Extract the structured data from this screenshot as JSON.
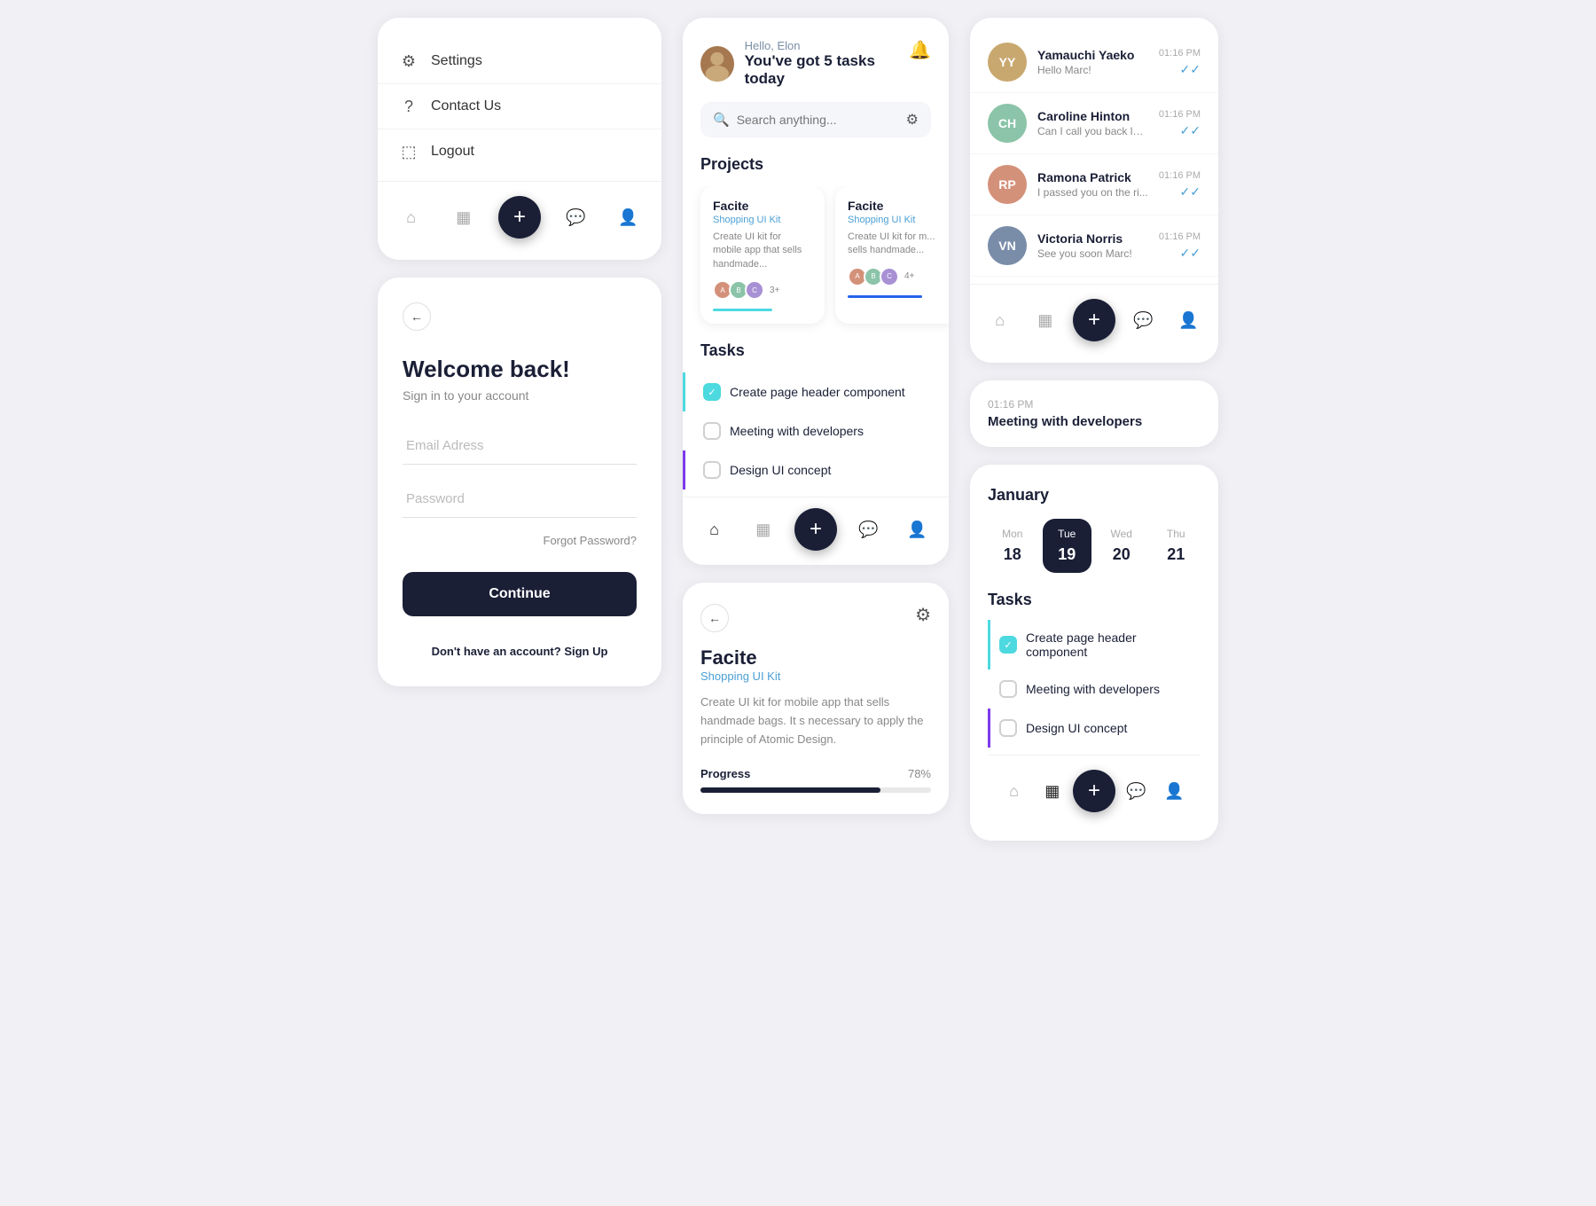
{
  "leftCol": {
    "menu": {
      "items": [
        {
          "icon": "⚙️",
          "label": "Settings"
        },
        {
          "icon": "?",
          "label": "Contact Us"
        },
        {
          "icon": "⬛",
          "label": "Logout"
        }
      ]
    },
    "login": {
      "backLabel": "←",
      "title": "Welcome back!",
      "subtitle": "Sign in to your account",
      "emailPlaceholder": "Email Adress",
      "passwordPlaceholder": "Password",
      "forgotLabel": "Forgot Password?",
      "continueLabel": "Continue",
      "noAccountText": "Don't have an account?",
      "signUpLabel": "Sign Up"
    }
  },
  "midCol": {
    "home": {
      "greeting": "Hello, Elon",
      "taskSummary": "You've got 5 tasks today",
      "searchPlaceholder": "Search anything...",
      "projectsTitle": "Projects",
      "projects": [
        {
          "name": "Facite",
          "sub": "Shopping UI Kit",
          "desc": "Create UI kit for mobile app that sells handmade...",
          "avatars": [
            "A",
            "B",
            "C"
          ],
          "count": "3+",
          "progClass": "prog-cyan"
        },
        {
          "name": "Facite",
          "sub": "Shopping UI Kit",
          "desc": "Create UI kit for m... sells handmade...",
          "avatars": [
            "A",
            "B",
            "C"
          ],
          "count": "4+",
          "progClass": "prog-blue"
        }
      ],
      "tasksTitle": "Tasks",
      "tasks": [
        {
          "label": "Create page header component",
          "checked": true,
          "borderClass": "cyan-border"
        },
        {
          "label": "Meeting with developers",
          "checked": false,
          "borderClass": ""
        },
        {
          "label": "Design UI concept",
          "checked": false,
          "borderClass": "purple-border"
        }
      ]
    },
    "projectDetail": {
      "backLabel": "←",
      "settingsIcon": "⚙️",
      "title": "Facite",
      "subtitle": "Shopping UI Kit",
      "desc": "Create UI kit for mobile app that sells handmade bags. It s necessary to apply the principle of Atomic Design.",
      "progressLabel": "Progress",
      "progressPct": "78%",
      "progressValue": 78
    }
  },
  "rightCol": {
    "messages": {
      "contacts": [
        {
          "name": "Yamauchi Yaeko",
          "preview": "Hello Marc!",
          "time": "01:16 PM",
          "avatarColor": "#c9a870",
          "initials": "YY"
        },
        {
          "name": "Caroline Hinton",
          "preview": "Can I call you back later? ...",
          "time": "01:16 PM",
          "avatarColor": "#8bc4a8",
          "initials": "CH"
        },
        {
          "name": "Ramona Patrick",
          "preview": "I passed you on the ri...",
          "time": "01:16 PM",
          "avatarColor": "#d4917a",
          "initials": "RP"
        },
        {
          "name": "Victoria Norris",
          "preview": "See you soon Marc!",
          "time": "01:16 PM",
          "avatarColor": "#7a8da8",
          "initials": "VN"
        }
      ]
    },
    "calendar": {
      "month": "January",
      "days": [
        {
          "name": "Mon",
          "num": "18",
          "active": false
        },
        {
          "name": "Tue",
          "num": "19",
          "active": true
        },
        {
          "name": "Wed",
          "num": "20",
          "active": false
        },
        {
          "name": "Thu",
          "num": "21",
          "active": false
        }
      ],
      "tasksTitle": "Tasks",
      "tasks": [
        {
          "label": "Create page header component",
          "checked": true,
          "borderClass": "cyan"
        },
        {
          "label": "Meeting with developers",
          "checked": false,
          "borderClass": ""
        },
        {
          "label": "Design UI concept",
          "checked": false,
          "borderClass": "purple"
        }
      ]
    },
    "meetingCard": {
      "title": "Meeting with developers",
      "time": "01:16 PM"
    }
  }
}
